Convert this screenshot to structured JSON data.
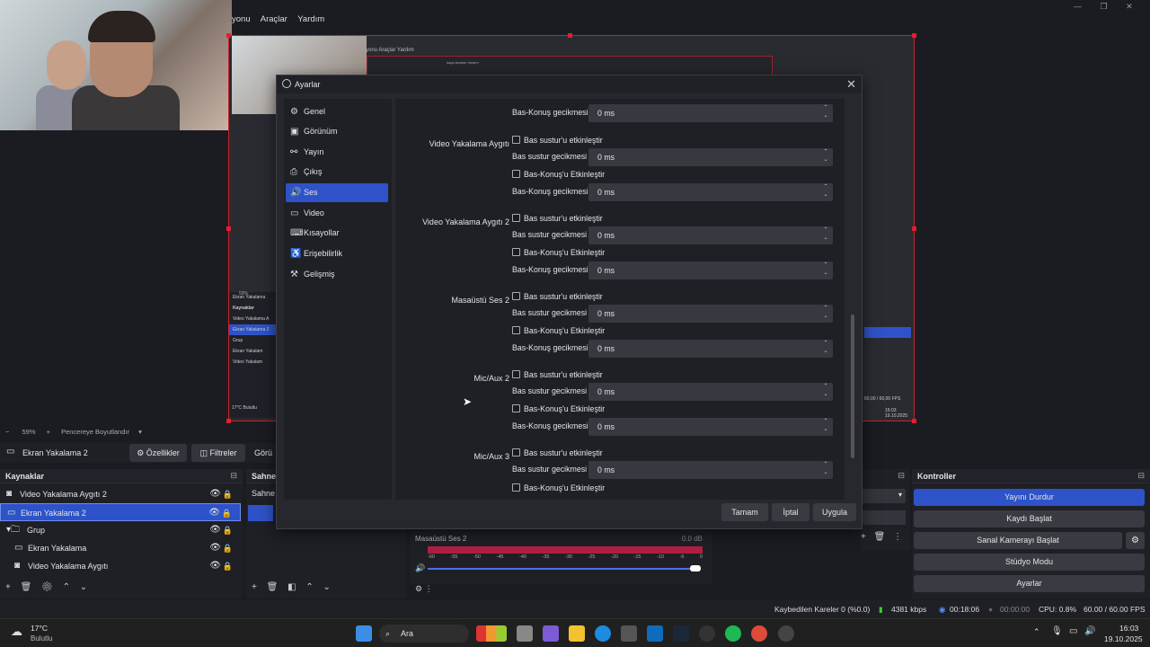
{
  "menubar": {
    "items": [
      "yonu",
      "Araçlar",
      "Yardım"
    ]
  },
  "nested": {
    "menu": "yonu  Araçlar  Yardım",
    "submenu": "kaya  Araçlar  Yardım"
  },
  "mini_sources": [
    "Ekran Yakalama",
    "Kaynaklar",
    "Video Yakalama A",
    "Ekran Yakalama 2",
    "Grup",
    "Ekran Yakalam",
    "Video Yakalam"
  ],
  "mini_right": {
    "fps": "60,00 / 60,00 FPS",
    "time": "16:03",
    "date": "19.10.2025",
    "weather": "17°C Bulutlu",
    "zoom": "59%"
  },
  "dialog": {
    "title": "Ayarlar",
    "close": "✕",
    "sidebar": [
      {
        "label": "Genel",
        "icon": "gear-icon",
        "glyph": "⚙"
      },
      {
        "label": "Görünüm",
        "icon": "appearance-icon",
        "glyph": "▣"
      },
      {
        "label": "Yayın",
        "icon": "stream-icon",
        "glyph": "⚯"
      },
      {
        "label": "Çıkış",
        "icon": "output-icon",
        "glyph": "⎙"
      },
      {
        "label": "Ses",
        "icon": "audio-icon",
        "glyph": "🔊"
      },
      {
        "label": "Video",
        "icon": "video-icon",
        "glyph": "▭"
      },
      {
        "label": "Kısayollar",
        "icon": "keyboard-icon",
        "glyph": "⌨"
      },
      {
        "label": "Erişebilirlik",
        "icon": "accessibility-icon",
        "glyph": "♿"
      },
      {
        "label": "Gelişmiş",
        "icon": "advanced-icon",
        "glyph": "⚒"
      }
    ],
    "top_partial": {
      "label": "Bas-Konuş gecikmesi",
      "value": "0 ms"
    },
    "groups": [
      {
        "name": "Video Yakalama Aygıtı",
        "mute_chk": "Bas sustur'u etkinleştir",
        "mute_delay": "Bas sustur gecikmesi",
        "mute_val": "0 ms",
        "ptt_chk": "Bas-Konuş'u Etkinleştir",
        "ptt_delay": "Bas-Konuş gecikmesi",
        "ptt_val": "0 ms"
      },
      {
        "name": "Video Yakalama Aygıtı 2",
        "mute_chk": "Bas sustur'u etkinleştir",
        "mute_delay": "Bas sustur gecikmesi",
        "mute_val": "0 ms",
        "ptt_chk": "Bas-Konuş'u Etkinleştir",
        "ptt_delay": "Bas-Konuş gecikmesi",
        "ptt_val": "0 ms"
      },
      {
        "name": "Masaüstü Ses 2",
        "mute_chk": "Bas sustur'u etkinleştir",
        "mute_delay": "Bas sustur gecikmesi",
        "mute_val": "0 ms",
        "ptt_chk": "Bas-Konuş'u Etkinleştir",
        "ptt_delay": "Bas-Konuş gecikmesi",
        "ptt_val": "0 ms"
      },
      {
        "name": "Mic/Aux 2",
        "mute_chk": "Bas sustur'u etkinleştir",
        "mute_delay": "Bas sustur gecikmesi",
        "mute_val": "0 ms",
        "ptt_chk": "Bas-Konuş'u Etkinleştir",
        "ptt_delay": "Bas-Konuş gecikmesi",
        "ptt_val": "0 ms"
      },
      {
        "name": "Mic/Aux 3",
        "mute_chk": "Bas sustur'u etkinleştir",
        "mute_delay": "Bas sustur gecikmesi",
        "mute_val": "0 ms",
        "ptt_chk": "Bas-Konuş'u Etkinleştir"
      }
    ],
    "buttons": {
      "ok": "Tamam",
      "cancel": "İptal",
      "apply": "Uygula"
    }
  },
  "preview_status": {
    "zoom": "59%",
    "fit": "Pencereye Boyutlandır"
  },
  "toolbar": {
    "selected": "Ekran Yakalama 2",
    "properties": "Özellikler",
    "filters": "Filtreler",
    "more": "Görü"
  },
  "sources": {
    "title": "Kaynaklar",
    "items": [
      {
        "label": "Video Yakalama Aygıtı 2",
        "icon": "camera-icon",
        "glyph": "◙",
        "indent": 0
      },
      {
        "label": "Ekran Yakalama 2",
        "icon": "monitor-icon",
        "glyph": "▭",
        "indent": 0,
        "selected": true
      },
      {
        "label": "Grup",
        "icon": "folder-icon",
        "glyph": "▾ 🗀",
        "indent": 0
      },
      {
        "label": "Ekran Yakalama",
        "icon": "monitor-icon",
        "glyph": "▭",
        "indent": 1
      },
      {
        "label": "Video Yakalama Aygıtı",
        "icon": "camera-icon",
        "glyph": "◙",
        "indent": 1
      }
    ]
  },
  "scenes": {
    "title": "Sahne",
    "item": "Sahne"
  },
  "mixer": {
    "source": "Masaüstü Ses 2",
    "db": "0.0 dB",
    "ticks": [
      "-60",
      "-55",
      "-50",
      "-45",
      "-40",
      "-35",
      "-30",
      "-25",
      "-20",
      "-15",
      "-10",
      "-5",
      "0"
    ]
  },
  "controls": {
    "title": "Kontroller",
    "items": [
      "Yayını Durdur",
      "Kaydı Başlat",
      "Sanal Kamerayı Başlat",
      "Stüdyo Modu",
      "Ayarlar"
    ]
  },
  "statusbar": {
    "dropped": "Kaybedilen Kareler 0 (%0.0)",
    "kbps": "4381 kbps",
    "stream_time": "00:18:06",
    "rec_time": "00:00:00",
    "cpu": "CPU: 0.8%",
    "fps": "60.00 / 60.00 FPS"
  },
  "taskbar": {
    "weather_temp": "17°C",
    "weather_desc": "Bulutlu",
    "search": "Ara",
    "time": "16:03",
    "date": "19.10.2025"
  }
}
